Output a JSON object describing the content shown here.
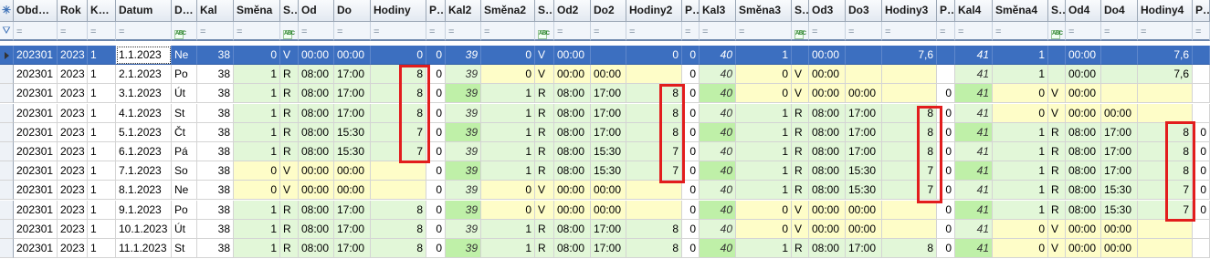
{
  "header": {
    "corner_icon": "asterisk-icon",
    "columns": [
      "Obd…",
      "Rok",
      "K…",
      "Datum",
      "D…",
      "Kal",
      "Směna",
      "S…",
      "Od",
      "Do",
      "Hodiny",
      "P…",
      "Kal2",
      "Směna2",
      "S…",
      "Od2",
      "Do2",
      "Hodiny2",
      "P…",
      "Kal3",
      "Směna3",
      "S…",
      "Od3",
      "Do3",
      "Hodiny3",
      "P…",
      "Kal4",
      "Směna4",
      "S…",
      "Od4",
      "Do4",
      "Hodiny4",
      "P…"
    ]
  },
  "filter_row": {
    "icon": "filter-funnel-icon",
    "eq_symbol": "=",
    "text_filter_icon": "abc-text-filter-icon",
    "text_filter_label": "ABC"
  },
  "rows": [
    {
      "selected": true,
      "cells": [
        "202301",
        "2023",
        "1",
        "1.1.2023",
        "Ne",
        "38",
        "0",
        "V",
        "00:00",
        "00:00",
        "0",
        "0",
        "39",
        "0",
        "V",
        "00:00",
        "",
        "0",
        "0",
        "40",
        "1",
        "",
        "00:00",
        "",
        "7,6",
        "",
        "41",
        "1",
        "",
        "00:00",
        "",
        "7,6",
        ""
      ]
    },
    {
      "cells": [
        "202301",
        "2023",
        "1",
        "2.1.2023",
        "Po",
        "38",
        "1",
        "R",
        "08:00",
        "17:00",
        "8",
        "0",
        "39",
        "0",
        "V",
        "00:00",
        "00:00",
        "",
        "0",
        "40",
        "0",
        "V",
        "00:00",
        "",
        "",
        "",
        "41",
        "1",
        "",
        "00:00",
        "",
        "7,6",
        ""
      ]
    },
    {
      "cells": [
        "202301",
        "2023",
        "1",
        "3.1.2023",
        "Út",
        "38",
        "1",
        "R",
        "08:00",
        "17:00",
        "8",
        "0",
        "39",
        "1",
        "R",
        "08:00",
        "17:00",
        "8",
        "0",
        "40",
        "0",
        "V",
        "00:00",
        "00:00",
        "",
        "0",
        "41",
        "0",
        "V",
        "00:00",
        "",
        "",
        ""
      ]
    },
    {
      "cells": [
        "202301",
        "2023",
        "1",
        "4.1.2023",
        "St",
        "38",
        "1",
        "R",
        "08:00",
        "17:00",
        "8",
        "0",
        "39",
        "1",
        "R",
        "08:00",
        "17:00",
        "8",
        "0",
        "40",
        "1",
        "R",
        "08:00",
        "17:00",
        "8",
        "0",
        "41",
        "0",
        "V",
        "00:00",
        "00:00",
        "",
        ""
      ]
    },
    {
      "cells": [
        "202301",
        "2023",
        "1",
        "5.1.2023",
        "Čt",
        "38",
        "1",
        "R",
        "08:00",
        "15:30",
        "7",
        "0",
        "39",
        "1",
        "R",
        "08:00",
        "17:00",
        "8",
        "0",
        "40",
        "1",
        "R",
        "08:00",
        "17:00",
        "8",
        "0",
        "41",
        "1",
        "R",
        "08:00",
        "17:00",
        "8",
        "0"
      ]
    },
    {
      "cells": [
        "202301",
        "2023",
        "1",
        "6.1.2023",
        "Pá",
        "38",
        "1",
        "R",
        "08:00",
        "15:30",
        "7",
        "0",
        "39",
        "1",
        "R",
        "08:00",
        "15:30",
        "7",
        "0",
        "40",
        "1",
        "R",
        "08:00",
        "17:00",
        "8",
        "0",
        "41",
        "1",
        "R",
        "08:00",
        "17:00",
        "8",
        "0"
      ]
    },
    {
      "cells": [
        "202301",
        "2023",
        "1",
        "7.1.2023",
        "So",
        "38",
        "0",
        "V",
        "00:00",
        "00:00",
        "",
        "0",
        "39",
        "1",
        "R",
        "08:00",
        "15:30",
        "7",
        "0",
        "40",
        "1",
        "R",
        "08:00",
        "15:30",
        "7",
        "0",
        "41",
        "1",
        "R",
        "08:00",
        "17:00",
        "8",
        "0"
      ]
    },
    {
      "cells": [
        "202301",
        "2023",
        "1",
        "8.1.2023",
        "Ne",
        "38",
        "0",
        "V",
        "00:00",
        "00:00",
        "",
        "0",
        "39",
        "0",
        "V",
        "00:00",
        "00:00",
        "",
        "0",
        "40",
        "1",
        "R",
        "08:00",
        "15:30",
        "7",
        "0",
        "41",
        "1",
        "R",
        "08:00",
        "15:30",
        "7",
        "0"
      ]
    },
    {
      "cells": [
        "202301",
        "2023",
        "1",
        "9.1.2023",
        "Po",
        "38",
        "1",
        "R",
        "08:00",
        "17:00",
        "8",
        "0",
        "39",
        "0",
        "V",
        "00:00",
        "00:00",
        "",
        "0",
        "40",
        "0",
        "V",
        "00:00",
        "00:00",
        "",
        "0",
        "41",
        "1",
        "R",
        "08:00",
        "15:30",
        "7",
        "0"
      ]
    },
    {
      "cells": [
        "202301",
        "2023",
        "1",
        "10.1.2023",
        "Út",
        "38",
        "1",
        "R",
        "08:00",
        "17:00",
        "8",
        "0",
        "39",
        "1",
        "R",
        "08:00",
        "17:00",
        "8",
        "0",
        "40",
        "0",
        "V",
        "00:00",
        "00:00",
        "",
        "0",
        "41",
        "0",
        "V",
        "00:00",
        "00:00",
        "",
        ""
      ]
    },
    {
      "cells": [
        "202301",
        "2023",
        "1",
        "11.1.2023",
        "St",
        "38",
        "1",
        "R",
        "08:00",
        "17:00",
        "8",
        "0",
        "39",
        "1",
        "R",
        "08:00",
        "17:00",
        "8",
        "0",
        "40",
        "1",
        "R",
        "08:00",
        "17:00",
        "8",
        "0",
        "41",
        "0",
        "V",
        "00:00",
        "00:00",
        "",
        ""
      ]
    }
  ],
  "colors": {
    "selection": "#3c6fc0",
    "workday_cell": "#e2f7d8",
    "weekend_cell": "#fefdc8",
    "highlight_box": "#e21d1d"
  }
}
